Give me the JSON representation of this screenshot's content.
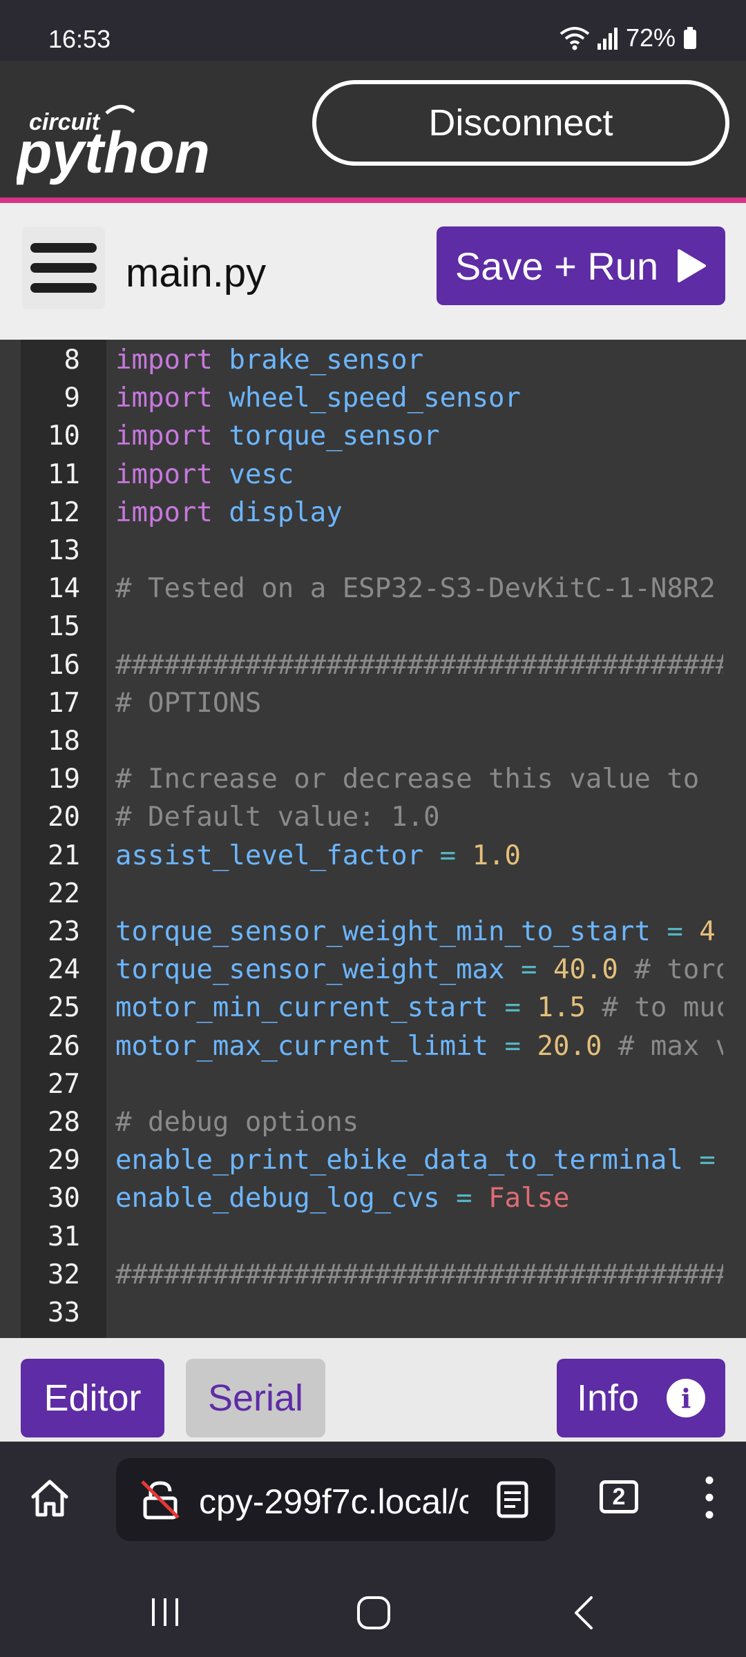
{
  "status_bar": {
    "time": "16:53",
    "battery": "72%"
  },
  "header": {
    "logo_text_top": "circuit",
    "logo_text_bottom": "python",
    "disconnect_label": "Disconnect"
  },
  "file_bar": {
    "filename": "main.py",
    "save_run_label": "Save + Run"
  },
  "editor": {
    "lines": [
      {
        "n": "8",
        "tokens": [
          [
            "kw",
            "import "
          ],
          [
            "id",
            "brake_sensor"
          ]
        ]
      },
      {
        "n": "9",
        "tokens": [
          [
            "kw",
            "import "
          ],
          [
            "id",
            "wheel_speed_sensor"
          ]
        ]
      },
      {
        "n": "10",
        "tokens": [
          [
            "kw",
            "import "
          ],
          [
            "id",
            "torque_sensor"
          ]
        ]
      },
      {
        "n": "11",
        "tokens": [
          [
            "kw",
            "import "
          ],
          [
            "id",
            "vesc"
          ]
        ]
      },
      {
        "n": "12",
        "tokens": [
          [
            "kw",
            "import "
          ],
          [
            "id",
            "display"
          ]
        ]
      },
      {
        "n": "13",
        "tokens": []
      },
      {
        "n": "14",
        "tokens": [
          [
            "cm",
            "# Tested on a ESP32-S3-DevKitC-1-N8R2"
          ]
        ]
      },
      {
        "n": "15",
        "tokens": []
      },
      {
        "n": "16",
        "tokens": [
          [
            "cm",
            "######################################"
          ]
        ]
      },
      {
        "n": "17",
        "tokens": [
          [
            "cm",
            "# OPTIONS"
          ]
        ]
      },
      {
        "n": "18",
        "tokens": []
      },
      {
        "n": "19",
        "tokens": [
          [
            "cm",
            "# Increase or decrease this value to "
          ]
        ]
      },
      {
        "n": "20",
        "tokens": [
          [
            "cm",
            "# Default value: 1.0"
          ]
        ]
      },
      {
        "n": "21",
        "tokens": [
          [
            "id",
            "assist_level_factor"
          ],
          [
            "op",
            " = "
          ],
          [
            "num",
            "1.0"
          ]
        ]
      },
      {
        "n": "22",
        "tokens": []
      },
      {
        "n": "23",
        "tokens": [
          [
            "id",
            "torque_sensor_weight_min_to_start"
          ],
          [
            "op",
            " = "
          ],
          [
            "num",
            "4"
          ]
        ]
      },
      {
        "n": "24",
        "tokens": [
          [
            "id",
            "torque_sensor_weight_max"
          ],
          [
            "op",
            " = "
          ],
          [
            "num",
            "40.0"
          ],
          [
            "cm",
            " # torq"
          ]
        ]
      },
      {
        "n": "25",
        "tokens": [
          [
            "id",
            "motor_min_current_start"
          ],
          [
            "op",
            " = "
          ],
          [
            "num",
            "1.5"
          ],
          [
            "cm",
            " # to muc"
          ]
        ]
      },
      {
        "n": "26",
        "tokens": [
          [
            "id",
            "motor_max_current_limit"
          ],
          [
            "op",
            " = "
          ],
          [
            "num",
            "20.0"
          ],
          [
            "cm",
            " # max v"
          ]
        ]
      },
      {
        "n": "27",
        "tokens": []
      },
      {
        "n": "28",
        "tokens": [
          [
            "cm",
            "# debug options"
          ]
        ]
      },
      {
        "n": "29",
        "tokens": [
          [
            "id",
            "enable_print_ebike_data_to_terminal"
          ],
          [
            "op",
            " ="
          ]
        ]
      },
      {
        "n": "30",
        "tokens": [
          [
            "id",
            "enable_debug_log_cvs"
          ],
          [
            "op",
            " = "
          ],
          [
            "bool",
            "False"
          ]
        ]
      },
      {
        "n": "31",
        "tokens": []
      },
      {
        "n": "32",
        "tokens": [
          [
            "cm",
            "######################################"
          ]
        ]
      },
      {
        "n": "33",
        "tokens": []
      }
    ]
  },
  "bottom_tabs": {
    "editor_label": "Editor",
    "serial_label": "Serial",
    "info_label": "Info",
    "info_icon_glyph": "i"
  },
  "browser": {
    "url": "cpy-299f7c.local/c",
    "tab_count": "2"
  },
  "colors": {
    "accent": "#5e2ca5",
    "header_stripe": "#d63384"
  }
}
